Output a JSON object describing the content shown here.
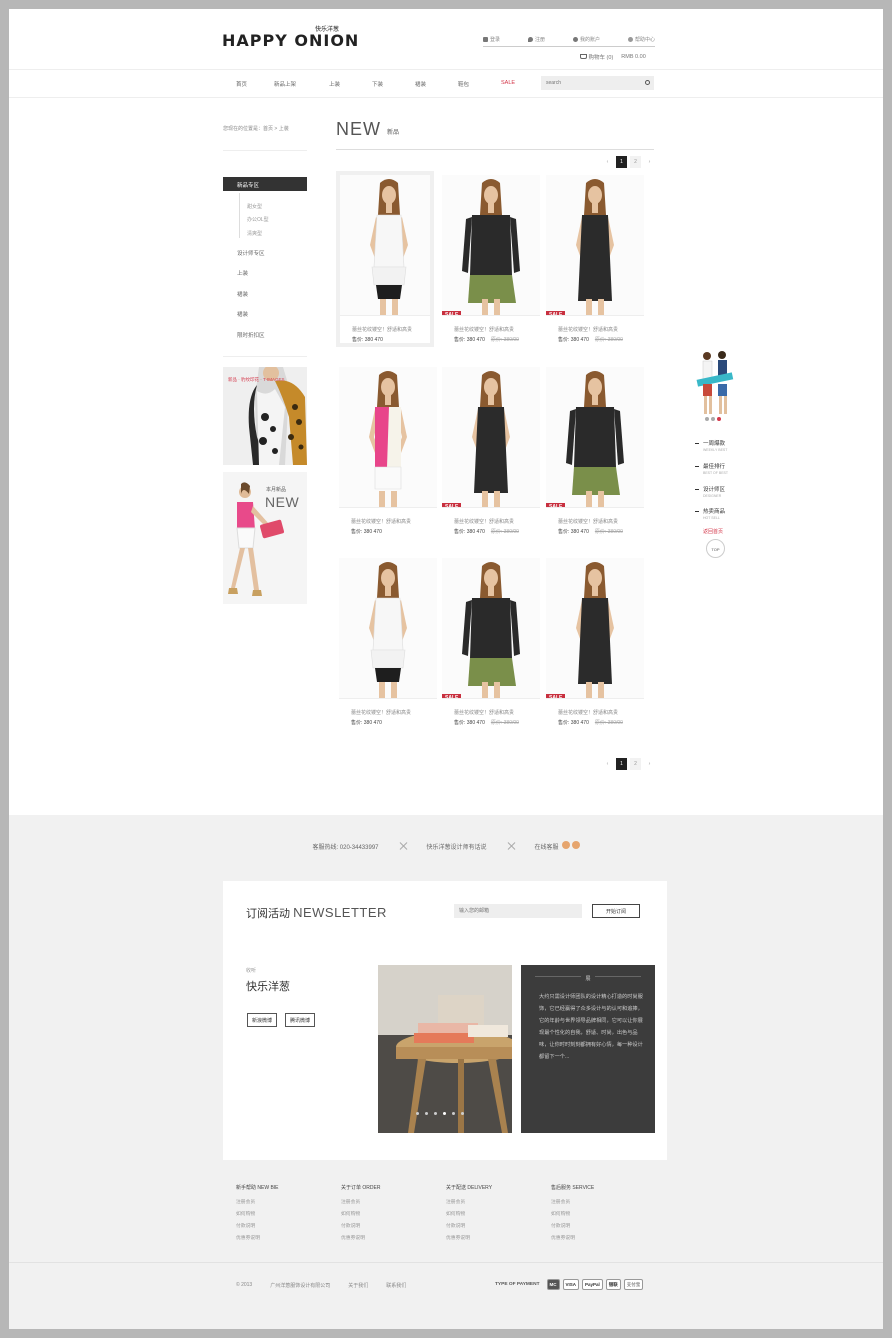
{
  "header": {
    "logo": "HAPPY ONION",
    "logo_cn": "快乐洋葱",
    "top_links": [
      "登录",
      "注册",
      "我的账户",
      "帮助中心"
    ],
    "cart_label": "购物车 (0)",
    "cart_total": "RMB 0.00"
  },
  "nav": {
    "items": [
      "首页",
      "新品上架",
      "上装",
      "下装",
      "裙装",
      "鞋包",
      "SALE"
    ],
    "search_placeholder": "search"
  },
  "sidebar": {
    "breadcrumb": "您现在的位置是：首页 > 上装",
    "active_category": "新品专区",
    "sub_items": [
      "甜女型",
      "办公OL型",
      "清爽型"
    ],
    "categories": [
      "设计师专区",
      "上装",
      "裙装",
      "裙装",
      "限时折扣区"
    ],
    "banner1_text": "新品 · 豹纹印花 · T-IMAGES",
    "banner2_sub": "本月新品",
    "banner2_title": "NEW"
  },
  "main": {
    "title": "NEW",
    "title_sub": "新品",
    "pages": [
      "‹",
      "1",
      "2",
      "›"
    ],
    "sale_label": "SALE",
    "products": [
      {
        "name": "蕾丝花纹镂空！舒适和高贵",
        "price": "售价: 380  470",
        "old_price": ""
      },
      {
        "name": "蕾丝花纹镂空！舒适和高贵",
        "price": "售价: 380  470",
        "old_price": "原价: 380/00"
      },
      {
        "name": "蕾丝花纹镂空！舒适和高贵",
        "price": "售价: 380  470",
        "old_price": "原价: 380/00"
      },
      {
        "name": "蕾丝花纹镂空！舒适和高贵",
        "price": "售价: 380  470",
        "old_price": ""
      },
      {
        "name": "蕾丝花纹镂空！舒适和高贵",
        "price": "售价: 380  470",
        "old_price": "原价: 380/00"
      },
      {
        "name": "蕾丝花纹镂空！舒适和高贵",
        "price": "售价: 380  470",
        "old_price": "原价: 380/00"
      },
      {
        "name": "蕾丝花纹镂空！舒适和高贵",
        "price": "售价: 380  470",
        "old_price": ""
      },
      {
        "name": "蕾丝花纹镂空！舒适和高贵",
        "price": "售价: 380  470",
        "old_price": "原价: 380/00"
      },
      {
        "name": "蕾丝花纹镂空！舒适和高贵",
        "price": "售价: 380  470",
        "old_price": "原价: 380/00"
      }
    ]
  },
  "float_menu": {
    "items": [
      {
        "label": "一周爆款",
        "en": "WEEKLY BEST"
      },
      {
        "label": "最佳排行",
        "en": "BEST OF BEST"
      },
      {
        "label": "设计师区",
        "en": "DESIGNER"
      },
      {
        "label": "热卖商品",
        "en": "HOT SELL"
      }
    ],
    "back_label": "返回首页",
    "top_label": "TOP"
  },
  "footer": {
    "hotline": "客服热线: 020-34433997",
    "designer_line": "快乐洋葱设计师有话说",
    "online_service": "在线客服",
    "newsletter_cn": "订阅活动",
    "newsletter_en": "NEWSLETTER",
    "newsletter_placeholder": "输入您的邮箱",
    "newsletter_button": "开始订阅",
    "follow_sub": "收听",
    "follow_title": "快乐洋葱",
    "follow_buttons": [
      "新浪微博",
      "腾讯微博"
    ],
    "story_head": "展",
    "story_text": "大约只需设计师团队的设计精心打造的时尚服饰，它已经赢得了众多设计与的认可和追捧，它的年龄与世界领导品牌相同，它可以让你展现最个性化的自我，舒适、时尚，出色与品味，让你时时刻刻都拥有好心情，每一种设计都留下一个..."
  },
  "footer_columns": [
    {
      "title": "新手帮助 NEW BIE",
      "links": [
        "注册会员",
        "如何购物",
        "付款说明",
        "优惠券说明"
      ]
    },
    {
      "title": "关于订单 ORDER",
      "links": [
        "注册会员",
        "如何购物",
        "付款说明",
        "优惠券说明"
      ]
    },
    {
      "title": "关于配送 DELIVERY",
      "links": [
        "注册会员",
        "如何购物",
        "付款说明",
        "优惠券说明"
      ]
    },
    {
      "title": "售后服务 SERVICE",
      "links": [
        "注册会员",
        "如何购物",
        "付款说明",
        "优惠券说明"
      ]
    }
  ],
  "bottom": {
    "copyright": "© 2013",
    "company": "广州洋葱服饰设计有限公司",
    "about": "关于我们",
    "contact": "联系我们",
    "payment_label": "TYPE OF PAYMENT",
    "payment_methods": [
      "MC",
      "VISA",
      "PayPal",
      "银联",
      "支付宝"
    ]
  },
  "colors": {
    "accent": "#d4374a",
    "dark": "#333333",
    "footer_bg": "#f1f1f1"
  }
}
